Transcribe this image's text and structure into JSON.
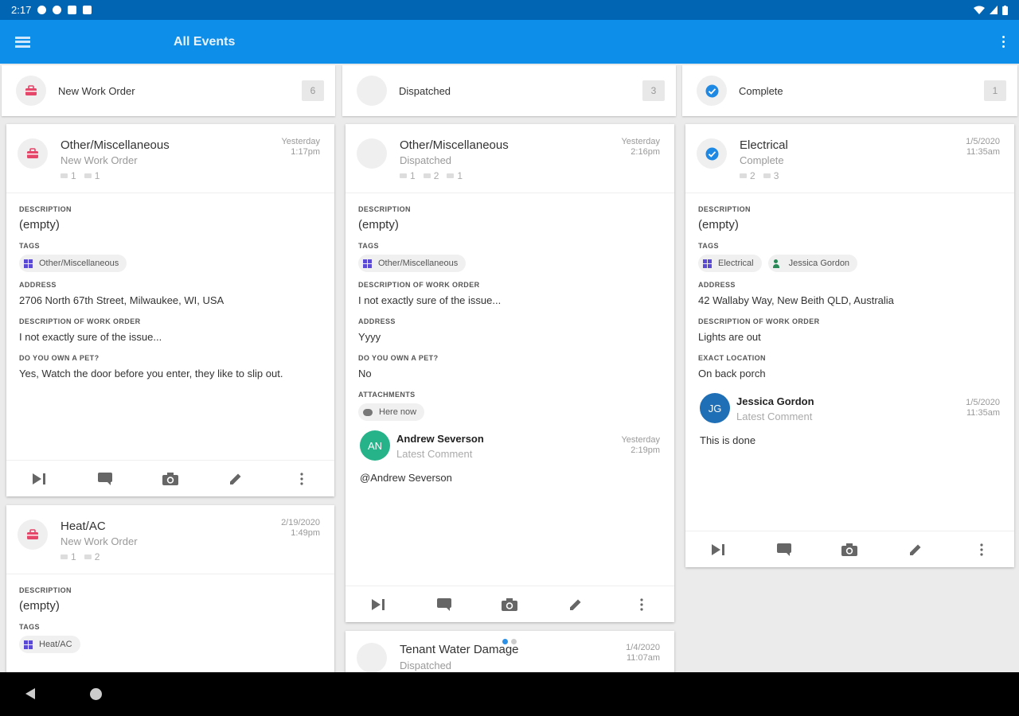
{
  "status_bar": {
    "time": "2:17"
  },
  "app_bar": {
    "title": "All Events"
  },
  "columns": [
    {
      "label": "New Work Order",
      "count": "6"
    },
    {
      "label": "Dispatched",
      "count": "3"
    },
    {
      "label": "Complete",
      "count": "1"
    }
  ],
  "cards": {
    "nwo1": {
      "title": "Other/Miscellaneous",
      "subtitle": "New Work Order",
      "tags_count": "1",
      "comments_count": "1",
      "date_line1": "Yesterday",
      "date_line2": "1:17pm",
      "labels": {
        "description": "DESCRIPTION",
        "tags": "TAGS",
        "address": "ADDRESS",
        "dwo": "DESCRIPTION OF WORK ORDER",
        "pet": "DO YOU OWN A PET?"
      },
      "description": "(empty)",
      "tag1": "Other/Miscellaneous",
      "address": "2706 North 67th Street, Milwaukee, WI, USA",
      "dwo": "I not exactly sure of the issue...",
      "pet": "Yes, Watch the door before you enter, they like to slip out."
    },
    "nwo2": {
      "title": "Heat/AC",
      "subtitle": "New Work Order",
      "tags_count": "1",
      "comments_count": "2",
      "date_line1": "2/19/2020",
      "date_line2": "1:49pm",
      "labels": {
        "description": "DESCRIPTION",
        "tags": "TAGS"
      },
      "description": "(empty)",
      "tag1": "Heat/AC"
    },
    "disp1": {
      "title": "Other/Miscellaneous",
      "subtitle": "Dispatched",
      "tags_count": "1",
      "comments_count": "2",
      "attachments_count": "1",
      "date_line1": "Yesterday",
      "date_line2": "2:16pm",
      "labels": {
        "description": "DESCRIPTION",
        "tags": "TAGS",
        "dwo": "DESCRIPTION OF WORK ORDER",
        "address": "ADDRESS",
        "pet": "DO YOU OWN A PET?",
        "attachments": "ATTACHMENTS"
      },
      "description": "(empty)",
      "tag1": "Other/Miscellaneous",
      "dwo": "I not exactly sure of the issue...",
      "address": "Yyyy",
      "pet": "No",
      "attachment1": "Here now",
      "comment": {
        "initials": "AN",
        "name": "Andrew Severson",
        "sub": "Latest Comment",
        "date_line1": "Yesterday",
        "date_line2": "2:19pm",
        "text": "@Andrew Severson"
      }
    },
    "disp2": {
      "title": "Tenant Water Damage",
      "subtitle": "Dispatched",
      "date_line1": "1/4/2020",
      "date_line2": "11:07am"
    },
    "comp1": {
      "title": "Electrical",
      "subtitle": "Complete",
      "tags_count": "2",
      "comments_count": "3",
      "date_line1": "1/5/2020",
      "date_line2": "11:35am",
      "labels": {
        "description": "DESCRIPTION",
        "tags": "TAGS",
        "address": "ADDRESS",
        "dwo": "DESCRIPTION OF WORK ORDER",
        "location": "EXACT LOCATION"
      },
      "description": "(empty)",
      "tag1": "Electrical",
      "tag2": "Jessica Gordon",
      "address": "42 Wallaby Way, New Beith QLD, Australia",
      "dwo": "Lights are out",
      "location": "On back porch",
      "comment": {
        "initials": "JG",
        "name": "Jessica Gordon",
        "sub": "Latest Comment",
        "date_line1": "1/5/2020",
        "date_line2": "11:35am",
        "text": "This is done"
      }
    }
  },
  "colors": {
    "status_bar": "#0265b4",
    "app_bar": "#0d8ee9",
    "new_work_order": "#e5476a",
    "complete": "#1e88e5",
    "tag_icon": "#5b4bd4",
    "avatar_an": "#26b38a",
    "avatar_jg": "#1f6fb6"
  },
  "icons": [
    "menu-icon",
    "more-vert-icon",
    "toolbox-icon",
    "check-circle-icon",
    "tag-icon",
    "comment-icon",
    "attachment-icon",
    "skip-next-icon",
    "camera-icon",
    "edit-icon",
    "cloud-icon",
    "person-icon"
  ]
}
